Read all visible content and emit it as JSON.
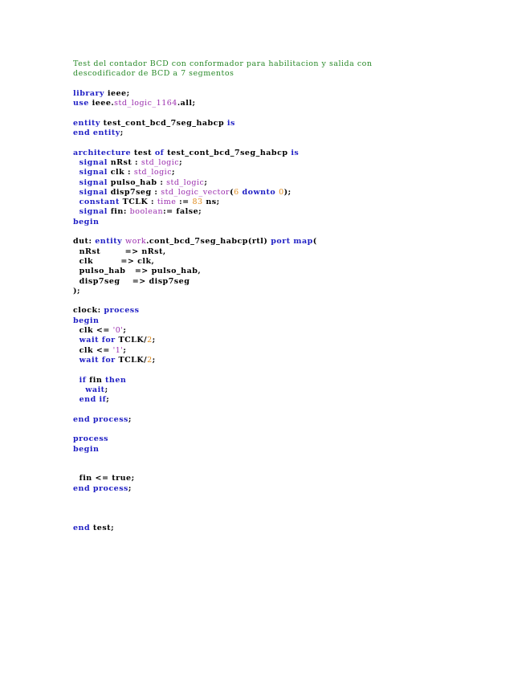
{
  "document": {
    "lines": [
      [
        {
          "t": "comment",
          "s": "Test del contador BCD con conformador para habilitacion y salida con"
        }
      ],
      [
        {
          "t": "comment",
          "s": "descodificador de BCD a 7 segmentos"
        }
      ],
      [],
      [
        {
          "t": "keyword",
          "s": "library"
        },
        {
          "t": "plain",
          "s": " ieee;"
        }
      ],
      [
        {
          "t": "keyword",
          "s": "use"
        },
        {
          "t": "plain",
          "s": " ieee."
        },
        {
          "t": "type",
          "s": "std_logic_1164"
        },
        {
          "t": "plain",
          "s": ".all;"
        }
      ],
      [],
      [
        {
          "t": "keyword",
          "s": "entity"
        },
        {
          "t": "plain",
          "s": " test_cont_bcd_7seg_habcp "
        },
        {
          "t": "keyword",
          "s": "is"
        }
      ],
      [
        {
          "t": "keyword",
          "s": "end entity"
        },
        {
          "t": "plain",
          "s": ";"
        }
      ],
      [],
      [
        {
          "t": "keyword",
          "s": "architecture"
        },
        {
          "t": "plain",
          "s": " test "
        },
        {
          "t": "keyword",
          "s": "of"
        },
        {
          "t": "plain",
          "s": " test_cont_bcd_7seg_habcp "
        },
        {
          "t": "keyword",
          "s": "is"
        }
      ],
      [
        {
          "t": "plain",
          "s": "  "
        },
        {
          "t": "keyword",
          "s": "signal"
        },
        {
          "t": "plain",
          "s": " nRst : "
        },
        {
          "t": "type",
          "s": "std_logic"
        },
        {
          "t": "plain",
          "s": ";"
        }
      ],
      [
        {
          "t": "plain",
          "s": "  "
        },
        {
          "t": "keyword",
          "s": "signal"
        },
        {
          "t": "plain",
          "s": " clk : "
        },
        {
          "t": "type",
          "s": "std_logic"
        },
        {
          "t": "plain",
          "s": ";"
        }
      ],
      [
        {
          "t": "plain",
          "s": "  "
        },
        {
          "t": "keyword",
          "s": "signal"
        },
        {
          "t": "plain",
          "s": " pulso_hab : "
        },
        {
          "t": "type",
          "s": "std_logic"
        },
        {
          "t": "plain",
          "s": ";"
        }
      ],
      [
        {
          "t": "plain",
          "s": "  "
        },
        {
          "t": "keyword",
          "s": "signal"
        },
        {
          "t": "plain",
          "s": " disp7seg : "
        },
        {
          "t": "type",
          "s": "std_logic_vector"
        },
        {
          "t": "plain",
          "s": "("
        },
        {
          "t": "number",
          "s": "6"
        },
        {
          "t": "plain",
          "s": " "
        },
        {
          "t": "keyword",
          "s": "downto"
        },
        {
          "t": "plain",
          "s": " "
        },
        {
          "t": "number",
          "s": "0"
        },
        {
          "t": "plain",
          "s": ");"
        }
      ],
      [
        {
          "t": "plain",
          "s": "  "
        },
        {
          "t": "keyword",
          "s": "constant"
        },
        {
          "t": "plain",
          "s": " TCLK : "
        },
        {
          "t": "type",
          "s": "time"
        },
        {
          "t": "plain",
          "s": " := "
        },
        {
          "t": "number",
          "s": "83"
        },
        {
          "t": "plain",
          "s": " ns;"
        }
      ],
      [
        {
          "t": "plain",
          "s": "  "
        },
        {
          "t": "keyword",
          "s": "signal"
        },
        {
          "t": "plain",
          "s": " fin: "
        },
        {
          "t": "type",
          "s": "boolean"
        },
        {
          "t": "plain",
          "s": ":= false;"
        }
      ],
      [
        {
          "t": "keyword",
          "s": "begin"
        }
      ],
      [],
      [
        {
          "t": "plain",
          "s": "dut: "
        },
        {
          "t": "keyword",
          "s": "entity"
        },
        {
          "t": "plain",
          "s": " "
        },
        {
          "t": "type",
          "s": "work"
        },
        {
          "t": "plain",
          "s": ".cont_bcd_7seg_habcp(rtl) "
        },
        {
          "t": "keyword",
          "s": "port map"
        },
        {
          "t": "plain",
          "s": "("
        }
      ],
      [
        {
          "t": "plain",
          "s": "  nRst        => nRst,"
        }
      ],
      [
        {
          "t": "plain",
          "s": "  clk         => clk,"
        }
      ],
      [
        {
          "t": "plain",
          "s": "  pulso_hab   => pulso_hab,"
        }
      ],
      [
        {
          "t": "plain",
          "s": "  disp7seg    => disp7seg"
        }
      ],
      [
        {
          "t": "plain",
          "s": ");"
        }
      ],
      [],
      [
        {
          "t": "plain",
          "s": "clock: "
        },
        {
          "t": "keyword",
          "s": "process"
        }
      ],
      [
        {
          "t": "keyword",
          "s": "begin"
        }
      ],
      [
        {
          "t": "plain",
          "s": "  clk <= "
        },
        {
          "t": "string",
          "s": "'0'"
        },
        {
          "t": "plain",
          "s": ";"
        }
      ],
      [
        {
          "t": "plain",
          "s": "  "
        },
        {
          "t": "keyword",
          "s": "wait for"
        },
        {
          "t": "plain",
          "s": " TCLK/"
        },
        {
          "t": "number",
          "s": "2"
        },
        {
          "t": "plain",
          "s": ";"
        }
      ],
      [
        {
          "t": "plain",
          "s": "  clk <= "
        },
        {
          "t": "string",
          "s": "'1'"
        },
        {
          "t": "plain",
          "s": ";"
        }
      ],
      [
        {
          "t": "plain",
          "s": "  "
        },
        {
          "t": "keyword",
          "s": "wait for"
        },
        {
          "t": "plain",
          "s": " TCLK/"
        },
        {
          "t": "number",
          "s": "2"
        },
        {
          "t": "plain",
          "s": ";"
        }
      ],
      [],
      [
        {
          "t": "plain",
          "s": "  "
        },
        {
          "t": "keyword",
          "s": "if"
        },
        {
          "t": "plain",
          "s": " fin "
        },
        {
          "t": "keyword",
          "s": "then"
        }
      ],
      [
        {
          "t": "plain",
          "s": "    "
        },
        {
          "t": "keyword",
          "s": "wait"
        },
        {
          "t": "plain",
          "s": ";"
        }
      ],
      [
        {
          "t": "plain",
          "s": "  "
        },
        {
          "t": "keyword",
          "s": "end if"
        },
        {
          "t": "plain",
          "s": ";"
        }
      ],
      [],
      [
        {
          "t": "keyword",
          "s": "end process"
        },
        {
          "t": "plain",
          "s": ";"
        }
      ],
      [],
      [
        {
          "t": "keyword",
          "s": "process"
        }
      ],
      [
        {
          "t": "keyword",
          "s": "begin"
        }
      ],
      [],
      [],
      [
        {
          "t": "plain",
          "s": "  fin <= true;"
        }
      ],
      [
        {
          "t": "keyword",
          "s": "end process"
        },
        {
          "t": "plain",
          "s": ";"
        }
      ],
      [],
      [],
      [],
      [
        {
          "t": "keyword",
          "s": "end"
        },
        {
          "t": "plain",
          "s": " test;"
        }
      ]
    ]
  },
  "colors": {
    "comment": "#2a8a2a",
    "keyword": "#1f1fc4",
    "type": "#9b2fae",
    "number": "#e08a1a",
    "string": "#9b2fae",
    "plain": "#000000"
  }
}
